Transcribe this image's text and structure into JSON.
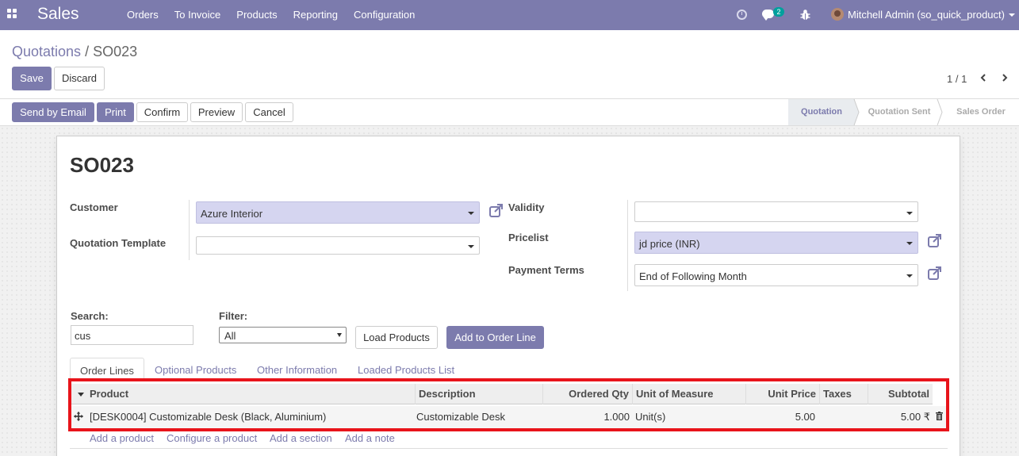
{
  "navbar": {
    "app_name": "Sales",
    "menu": [
      "Orders",
      "To Invoice",
      "Products",
      "Reporting",
      "Configuration"
    ],
    "chat_count": "2",
    "user": "Mitchell Admin (so_quick_product)"
  },
  "control_panel": {
    "breadcrumb_parent": "Quotations",
    "breadcrumb_separator": "/",
    "breadcrumb_current": "SO023",
    "save_label": "Save",
    "discard_label": "Discard",
    "pager": "1 / 1"
  },
  "statusbar": {
    "buttons": [
      "Send by Email",
      "Print",
      "Confirm",
      "Preview",
      "Cancel"
    ],
    "stages": [
      "Quotation",
      "Quotation Sent",
      "Sales Order"
    ],
    "active_stage": "Quotation"
  },
  "form": {
    "title": "SO023",
    "customer_label": "Customer",
    "customer_value": "Azure Interior",
    "template_label": "Quotation Template",
    "template_value": "",
    "validity_label": "Validity",
    "validity_value": "",
    "pricelist_label": "Pricelist",
    "pricelist_value": "jd price (INR)",
    "payment_terms_label": "Payment Terms",
    "payment_terms_value": "End of Following Month",
    "search_label": "Search:",
    "search_value": "cus",
    "filter_label": "Filter:",
    "filter_value": "All",
    "load_products_label": "Load Products",
    "add_to_order_label": "Add to Order Line"
  },
  "tabs": [
    "Order Lines",
    "Optional Products",
    "Other Information",
    "Loaded Products List"
  ],
  "order_lines": {
    "columns": [
      "Product",
      "Description",
      "Ordered Qty",
      "Unit of Measure",
      "Unit Price",
      "Taxes",
      "Subtotal"
    ],
    "rows": [
      {
        "product": "[DESK0004] Customizable Desk (Black, Aluminium)",
        "description": "Customizable Desk",
        "qty": "1.000",
        "uom": "Unit(s)",
        "unit_price": "5.00",
        "taxes": "",
        "subtotal": "5.00 ₹"
      }
    ],
    "links": [
      "Add a product",
      "Configure a product",
      "Add a section",
      "Add a note"
    ]
  },
  "colors": {
    "brand": "#7c7bad",
    "highlight": "#e8141b",
    "chat_badge": "#00a09d"
  }
}
